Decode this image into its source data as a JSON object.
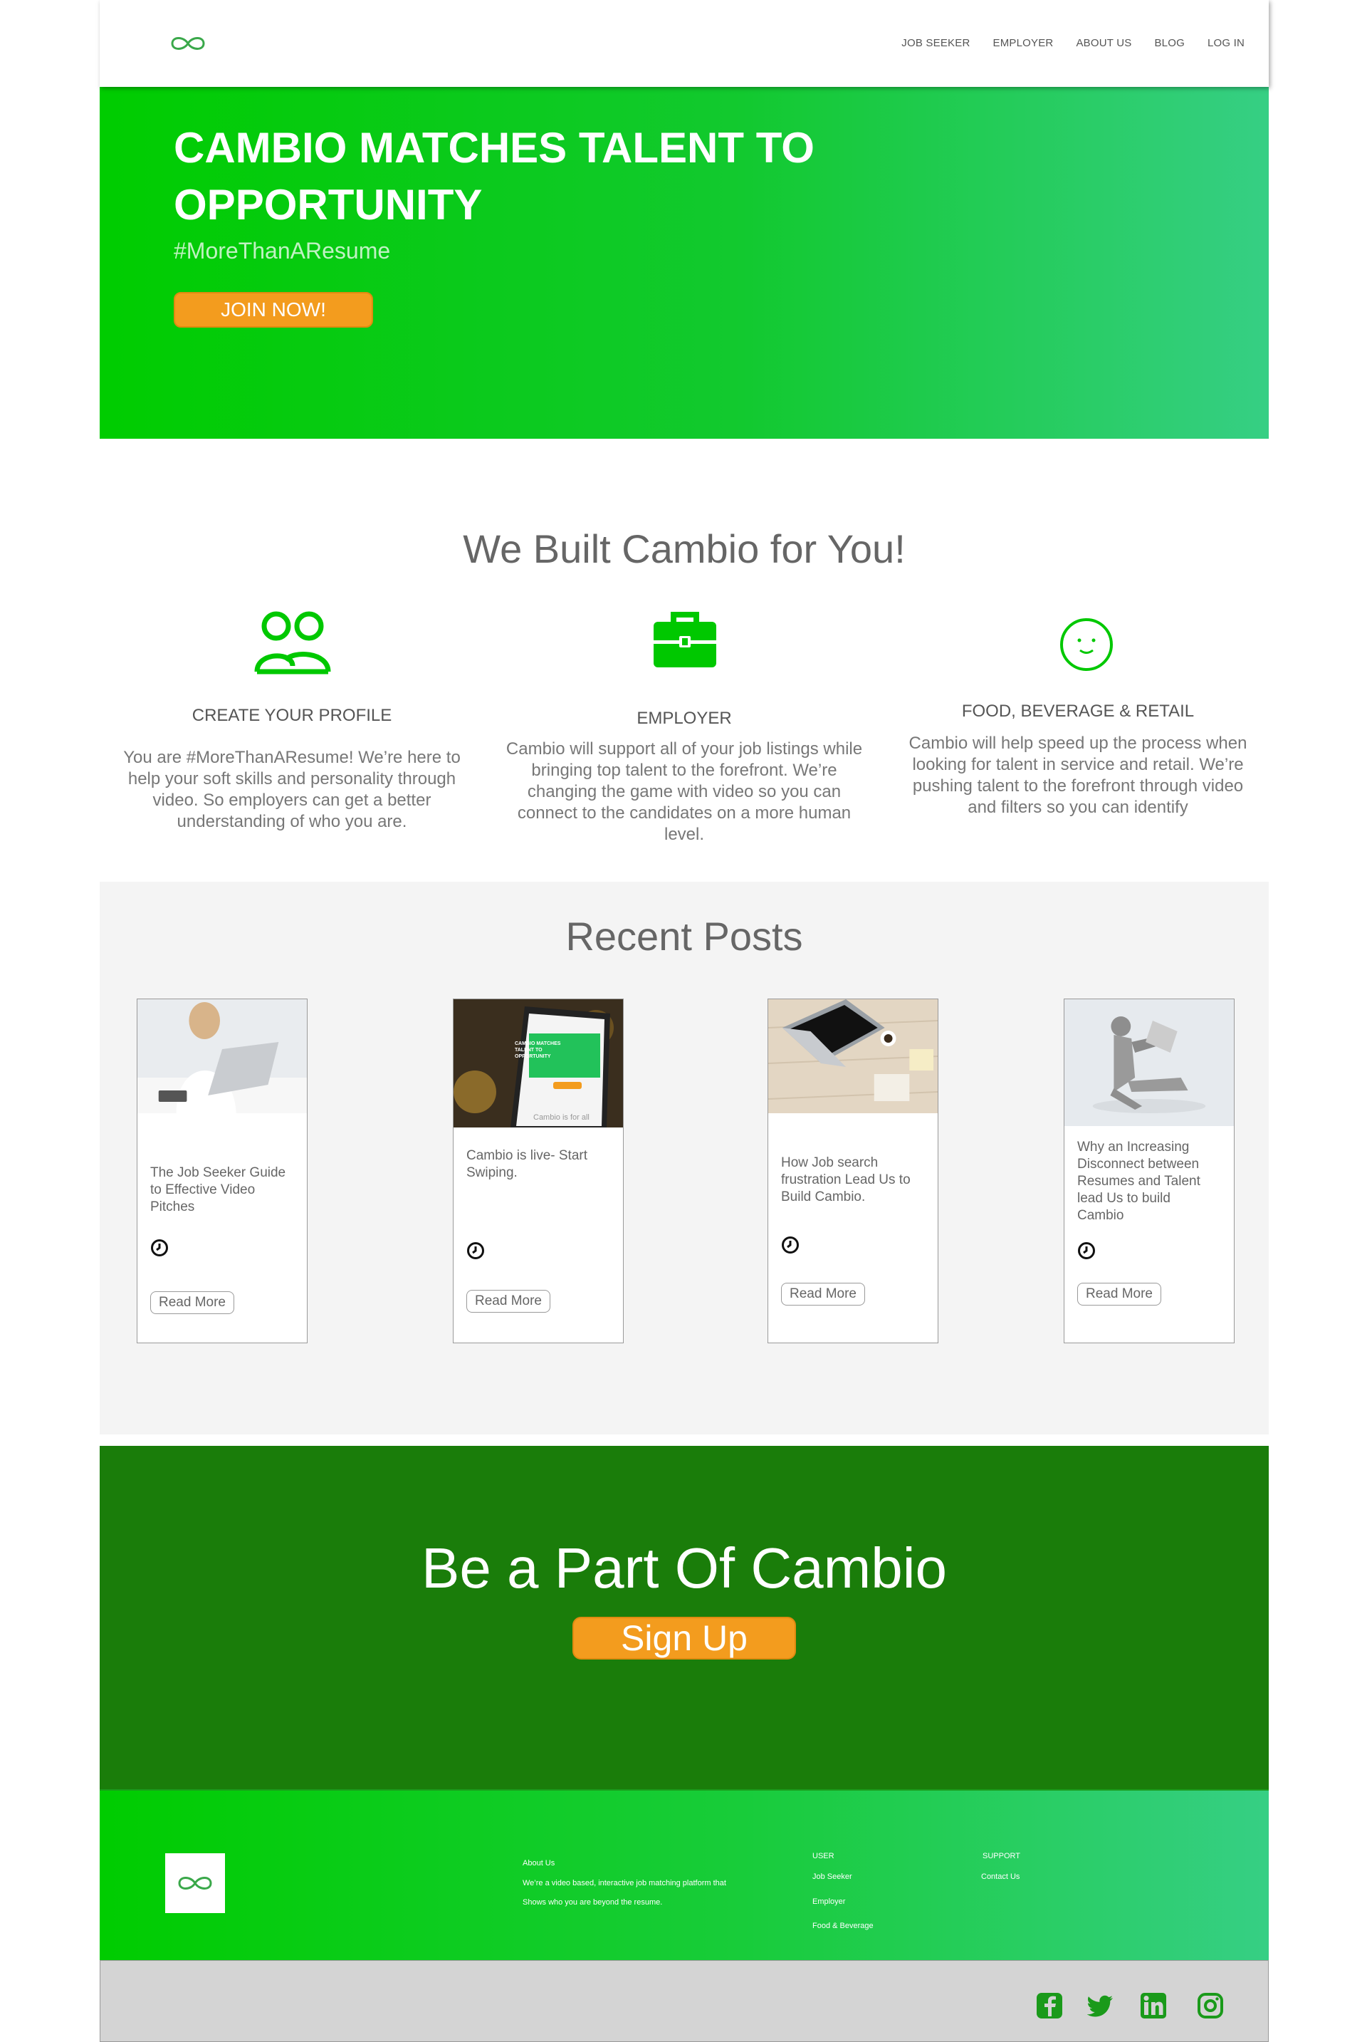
{
  "nav": {
    "logo_icon": "infinity-icon",
    "items": [
      "JOB SEEKER",
      "EMPLOYER",
      "ABOUT US",
      "BLOG",
      "LOG IN"
    ]
  },
  "hero": {
    "title": "CAMBIO MATCHES TALENT TO OPPORTUNITY",
    "tagline": "#MoreThanAResume",
    "button": "JOIN NOW!"
  },
  "built": {
    "title": "We Built Cambio for You!",
    "features": [
      {
        "icon": "people-icon",
        "title": "CREATE YOUR PROFILE",
        "desc": "You are #MoreThanAResume! We’re here to help your soft skills and personality through video. So employers can get a better understanding of who you are."
      },
      {
        "icon": "briefcase-icon",
        "title": "EMPLOYER",
        "desc": "Cambio will support all of your job listings while bringing top talent to the forefront. We’re changing the game with video so you can connect to the candidates on a more human level."
      },
      {
        "icon": "smiley-icon",
        "title": "FOOD, BEVERAGE & RETAIL",
        "desc": "Cambio will help speed up the process when looking for talent in service and retail. We’re pushing talent to the forefront through video and filters so you can identify"
      }
    ]
  },
  "recent": {
    "title": "Recent Posts",
    "posts": [
      {
        "title": "The Job Seeker Guide to Effective Video Pitches",
        "button": "Read More"
      },
      {
        "title": "Cambio is live- Start Swiping.",
        "button": "Read More",
        "phone_text": "CAMBIO MATCHES TALENT TO OPPORTUNITY",
        "phone_caption": "Cambio is for all"
      },
      {
        "title": "How Job search frustration Lead Us to Build Cambio.",
        "button": "Read More"
      },
      {
        "title": "Why an Increasing Disconnect between Resumes and Talent lead Us to build Cambio",
        "button": "Read More"
      }
    ]
  },
  "cta": {
    "title": "Be a Part Of Cambio",
    "button": "Sign Up"
  },
  "footer": {
    "about_heading": "About Us",
    "about_line1": "We’re a video based, interactive job matching platform that",
    "about_line2": "Shows who you are beyond the resume.",
    "user_heading": "USER",
    "user_links": [
      "Job Seeker",
      "Employer",
      "Food & Beverage"
    ],
    "support_heading": "SUPPORT",
    "support_links": [
      "Contact Us"
    ]
  },
  "social": [
    "facebook-icon",
    "twitter-icon",
    "linkedin-icon",
    "instagram-icon"
  ],
  "colors": {
    "brand_green": "#00cc00",
    "dark_green": "#1a7d0a",
    "accent_orange": "#f39c1e",
    "light_gray": "#f4f4f4"
  }
}
